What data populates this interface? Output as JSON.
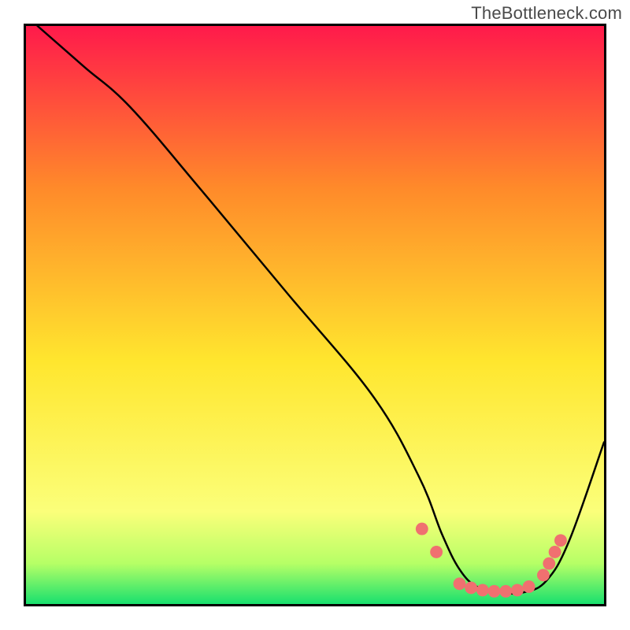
{
  "watermark": "TheBottleneck.com",
  "chart_data": {
    "type": "line",
    "title": "",
    "xlabel": "",
    "ylabel": "",
    "xlim": [
      0,
      100
    ],
    "ylim": [
      0,
      100
    ],
    "background_gradient": {
      "top": "#ff1a4b",
      "upper": "#ff8a2a",
      "mid": "#ffe62e",
      "lower": "#d8ff5c",
      "bottom": "#18e06e"
    },
    "series": [
      {
        "name": "curve",
        "type": "line",
        "color": "#000000",
        "x": [
          2,
          10,
          18,
          30,
          45,
          60,
          68,
          72,
          75,
          78,
          82,
          86,
          90,
          94,
          100
        ],
        "y": [
          100,
          93,
          86,
          72,
          54,
          36,
          22,
          12,
          6,
          3,
          2,
          2,
          4,
          11,
          28
        ]
      },
      {
        "name": "trough-dots",
        "type": "scatter",
        "color": "#f07070",
        "radius_px": 8,
        "x": [
          68.5,
          71,
          75,
          77,
          79,
          81,
          83,
          85,
          87,
          89.5,
          90.5,
          91.5,
          92.5
        ],
        "y": [
          13,
          9,
          3.5,
          2.8,
          2.4,
          2.2,
          2.2,
          2.4,
          3,
          5,
          7,
          9,
          11
        ]
      }
    ]
  }
}
